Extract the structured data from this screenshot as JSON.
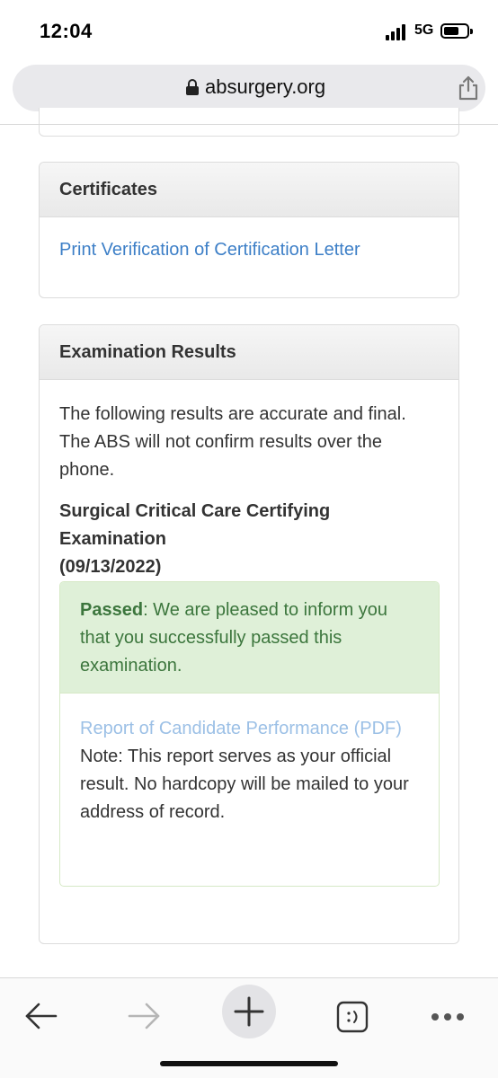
{
  "status_bar": {
    "time": "12:04",
    "network": "5G"
  },
  "browser": {
    "url": "absurgery.org"
  },
  "certificates": {
    "heading": "Certificates",
    "link": "Print Verification of Certification Letter"
  },
  "exam_results": {
    "heading": "Examination Results",
    "intro": "The following results are accurate and final. The ABS will not confirm results over the phone.",
    "exam_name": "Surgical Critical Care Certifying Examination",
    "exam_date": "(09/13/2022)",
    "result_status": "Passed",
    "result_message": ": We are pleased to inform you that you successfully passed this examination.",
    "report_link": "Report of Candidate Performance (PDF)",
    "note": "Note: This report serves as your official result. No hardcopy will be mailed to your address of record."
  },
  "colors": {
    "link": "#3d7fc7",
    "success_bg": "#dff0d8",
    "success_text": "#3c763d"
  },
  "icons": {
    "lock": "lock-icon",
    "share": "share-icon",
    "back": "back-arrow-icon",
    "forward": "forward-arrow-icon",
    "new_tab": "plus-icon",
    "tabs": "tabs-icon",
    "more": "more-dots-icon"
  }
}
